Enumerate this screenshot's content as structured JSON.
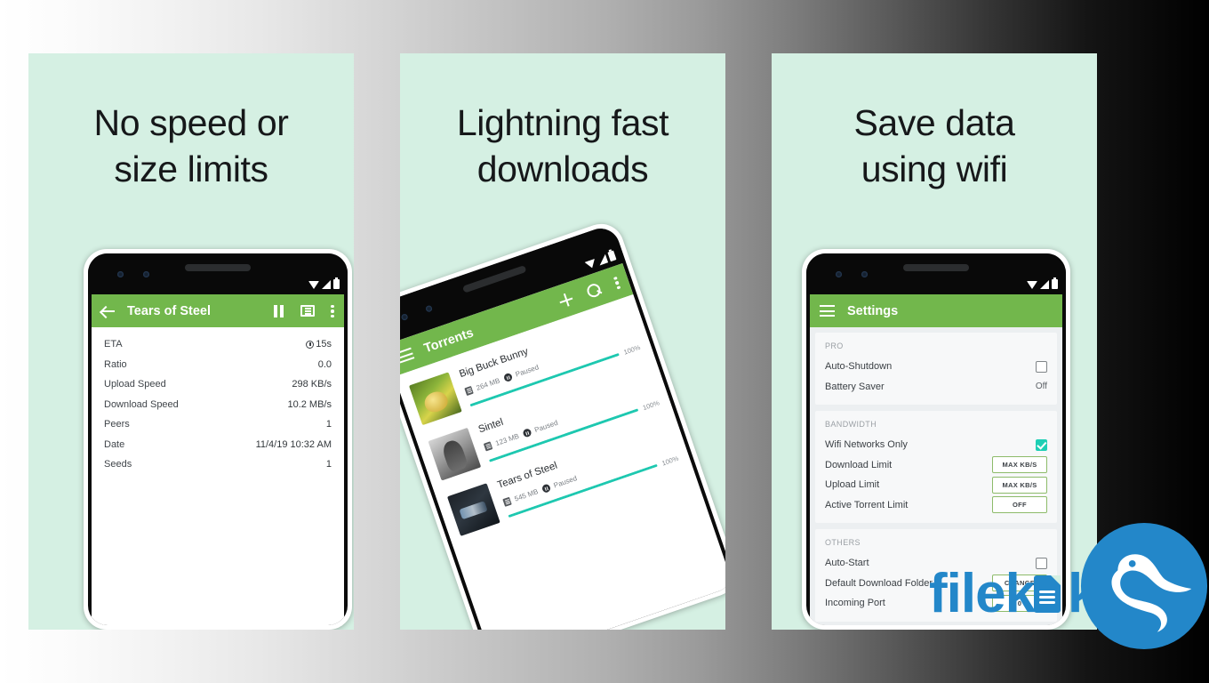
{
  "background": {
    "gradient_from": "#ffffff",
    "gradient_to": "#000000"
  },
  "theme": {
    "panel_bg": "#d5f0e3",
    "app_green": "#72b74c",
    "accent_teal": "#1ecfb4",
    "brand_blue": "#2387c9"
  },
  "panels": [
    {
      "headline": "No speed or\nsize limits",
      "phone": {
        "app_bar": {
          "title": "Tears of Steel",
          "nav_icon": "back-arrow-icon",
          "actions": [
            "pause-icon",
            "list-view-icon",
            "overflow-menu-icon"
          ]
        },
        "status_icons": [
          "wifi-icon",
          "signal-icon",
          "battery-icon"
        ],
        "detail_rows": [
          {
            "label": "ETA",
            "value": "15s",
            "icon": "clock-icon"
          },
          {
            "label": "Ratio",
            "value": "0.0"
          },
          {
            "label": "Upload Speed",
            "value": "298 KB/s"
          },
          {
            "label": "Download Speed",
            "value": "10.2 MB/s"
          },
          {
            "label": "Peers",
            "value": "1"
          },
          {
            "label": "Date",
            "value": "11/4/19 10:32 AM"
          },
          {
            "label": "Seeds",
            "value": "1"
          }
        ]
      }
    },
    {
      "headline": "Lightning fast\ndownloads",
      "phone": {
        "app_bar": {
          "title": "Torrents",
          "nav_icon": "hamburger-menu-icon",
          "actions": [
            "add-icon",
            "search-icon",
            "overflow-menu-icon"
          ]
        },
        "status_icons": [
          "wifi-icon",
          "signal-icon",
          "battery-icon"
        ],
        "torrents": [
          {
            "name": "Big Buck Bunny",
            "size": "264 MB",
            "status": "Paused",
            "percent": "100%",
            "progress": 100,
            "thumb": "bunny"
          },
          {
            "name": "Sintel",
            "size": "123 MB",
            "status": "Paused",
            "percent": "100%",
            "progress": 100,
            "thumb": "sintel"
          },
          {
            "name": "Tears of Steel",
            "size": "545 MB",
            "status": "Paused",
            "percent": "100%",
            "progress": 100,
            "thumb": "steel"
          }
        ]
      }
    },
    {
      "headline": "Save data\nusing wifi",
      "phone": {
        "app_bar": {
          "title": "Settings",
          "nav_icon": "hamburger-menu-icon",
          "actions": []
        },
        "status_icons": [
          "wifi-icon",
          "signal-icon",
          "battery-icon"
        ],
        "sections": [
          {
            "header": "PRO",
            "rows": [
              {
                "label": "Auto-Shutdown",
                "control": "checkbox",
                "checked": false
              },
              {
                "label": "Battery Saver",
                "control": "text",
                "value": "Off"
              }
            ]
          },
          {
            "header": "BANDWIDTH",
            "rows": [
              {
                "label": "Wifi Networks Only",
                "control": "checkbox",
                "checked": true
              },
              {
                "label": "Download Limit",
                "control": "pill",
                "value": "MAX KB/S"
              },
              {
                "label": "Upload Limit",
                "control": "pill",
                "value": "MAX KB/S"
              },
              {
                "label": "Active Torrent Limit",
                "control": "pill",
                "value": "OFF"
              }
            ]
          },
          {
            "header": "OTHERS",
            "rows": [
              {
                "label": "Auto-Start",
                "control": "checkbox",
                "checked": false
              },
              {
                "label": "Default Download Folder",
                "control": "pill",
                "value": "CHANGE"
              },
              {
                "label": "Incoming Port",
                "control": "pill",
                "value": "0"
              }
            ]
          }
        ]
      }
    }
  ],
  "watermark": {
    "text_before": "filek",
    "text_after": "ka",
    "full_text": "filekuka",
    "logo_icon": "kiwi-bird-logo-icon",
    "color": "#2387c9"
  }
}
